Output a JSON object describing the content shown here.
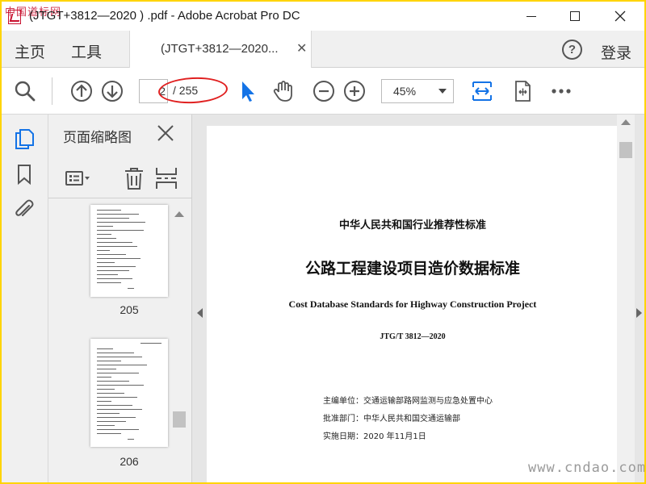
{
  "window": {
    "title": "(JTGT+3812—2020 ) .pdf - Adobe Acrobat Pro DC",
    "watermark_top": "中国道标网"
  },
  "tabs": {
    "home": "主页",
    "tools": "工具",
    "document_tab": "(JTGT+3812—2020...",
    "close_glyph": "✕",
    "help_glyph": "?",
    "login": "登录"
  },
  "toolbar": {
    "page_current": "2",
    "page_total": "/ 255",
    "zoom": "45%",
    "icons": [
      "search-icon",
      "page-up-icon",
      "page-down-icon",
      "select-cursor-icon",
      "hand-tool-icon",
      "zoom-out-icon",
      "zoom-in-icon",
      "fit-width-icon",
      "rotate-page-icon",
      "more-options-icon"
    ],
    "highlight_color": "#e02020",
    "accent_color": "#1473e6"
  },
  "left_rail": {
    "icons": [
      "page-thumbnails-icon",
      "bookmark-icon",
      "attachment-icon"
    ]
  },
  "thumbnails_panel": {
    "title": "页面缩略图",
    "close_glyph": "✕",
    "tools": [
      "thumbnail-options-icon",
      "delete-icon",
      "page-split-icon"
    ],
    "pages": [
      {
        "number": "205"
      },
      {
        "number": "206"
      }
    ]
  },
  "document": {
    "line1": "中华人民共和国行业推荐性标准",
    "line2": "公路工程建设项目造价数据标准",
    "line3": "Cost Database Standards for Highway Construction Project",
    "line4": "JTG/T  3812—2020",
    "meta": [
      "主编单位：交通运输部路网监测与应急处置中心",
      "批准部门：中华人民共和国交通运输部",
      "实施日期：2020 年11月1日"
    ]
  },
  "watermark_bottom": "www.cndao.com"
}
